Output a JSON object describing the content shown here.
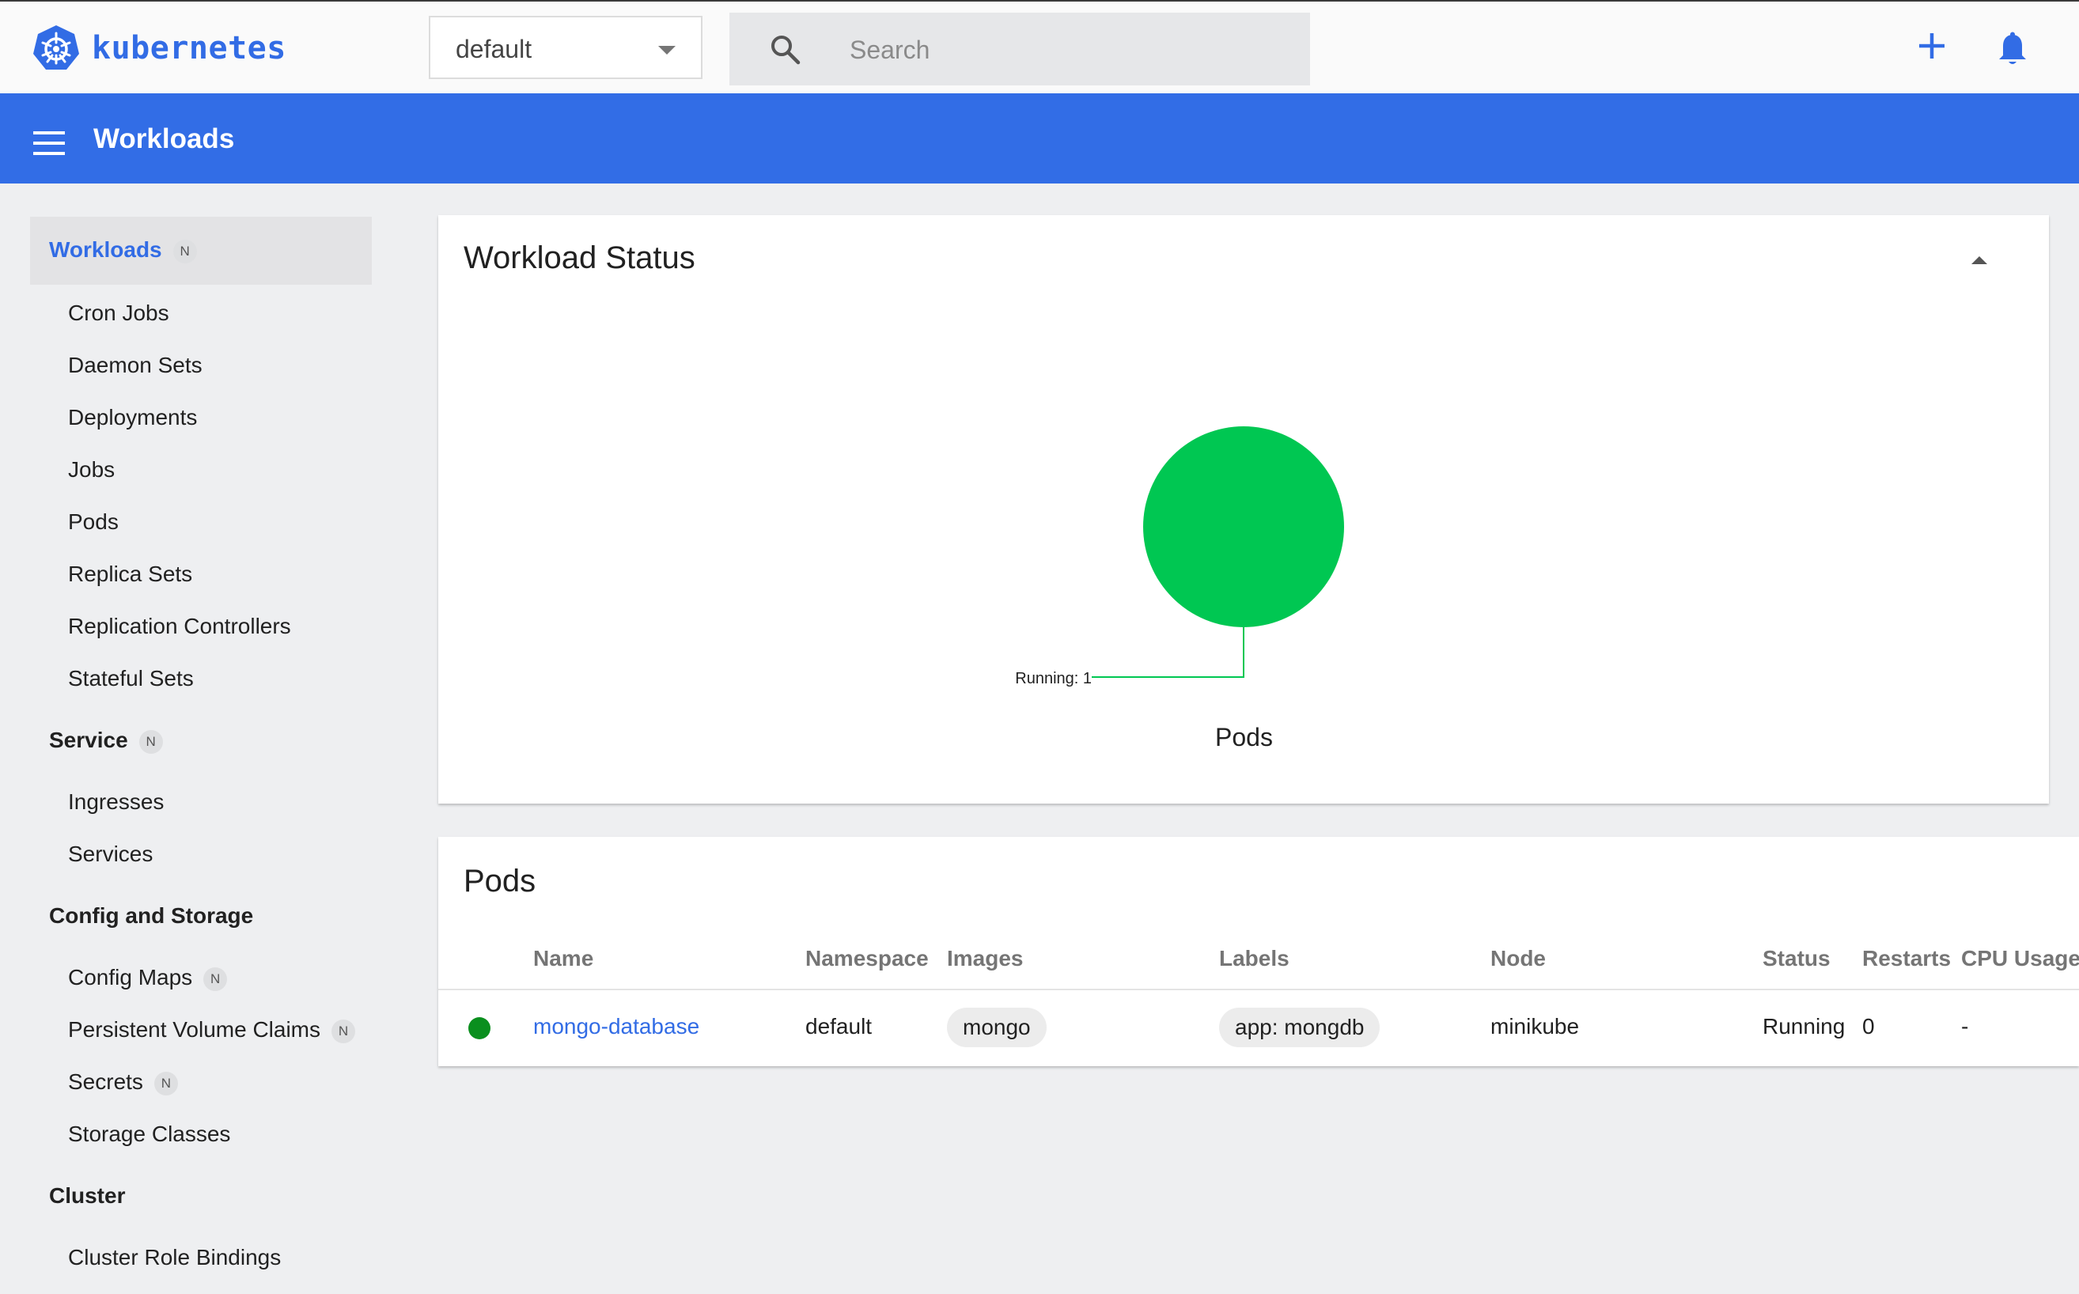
{
  "app": {
    "brand": "kubernetes"
  },
  "namespace": {
    "selected": "default"
  },
  "search": {
    "placeholder": "Search"
  },
  "header": {
    "title": "Workloads"
  },
  "sidebar": {
    "workloads": {
      "label": "Workloads",
      "badge": "N"
    },
    "workload_items": [
      "Cron Jobs",
      "Daemon Sets",
      "Deployments",
      "Jobs",
      "Pods",
      "Replica Sets",
      "Replication Controllers",
      "Stateful Sets"
    ],
    "service": {
      "label": "Service",
      "badge": "N"
    },
    "service_items": [
      "Ingresses",
      "Services"
    ],
    "config": {
      "label": "Config and Storage"
    },
    "config_items": [
      {
        "label": "Config Maps",
        "badge": "N"
      },
      {
        "label": "Persistent Volume Claims",
        "badge": "N"
      },
      {
        "label": "Secrets",
        "badge": "N"
      },
      {
        "label": "Storage Classes"
      }
    ],
    "cluster": {
      "label": "Cluster"
    },
    "cluster_items": [
      "Cluster Role Bindings"
    ]
  },
  "workload_status": {
    "title": "Workload Status",
    "chart_label": "Running: 1",
    "chart_caption": "Pods"
  },
  "chart_data": {
    "type": "pie",
    "title": "Pods",
    "slices": [
      {
        "label": "Running",
        "value": 1,
        "color": "#00c752"
      }
    ]
  },
  "pods": {
    "title": "Pods",
    "columns": [
      "Name",
      "Namespace",
      "Images",
      "Labels",
      "Node",
      "Status",
      "Restarts",
      "CPU Usage ("
    ],
    "rows": [
      {
        "name": "mongo-database",
        "namespace": "default",
        "image": "mongo",
        "label": "app: mongdb",
        "node": "minikube",
        "status": "Running",
        "restarts": "0",
        "cpu": "-"
      }
    ]
  },
  "colors": {
    "accent": "#326ce5",
    "running": "#00c752",
    "status_dot": "#0a8f1e"
  }
}
